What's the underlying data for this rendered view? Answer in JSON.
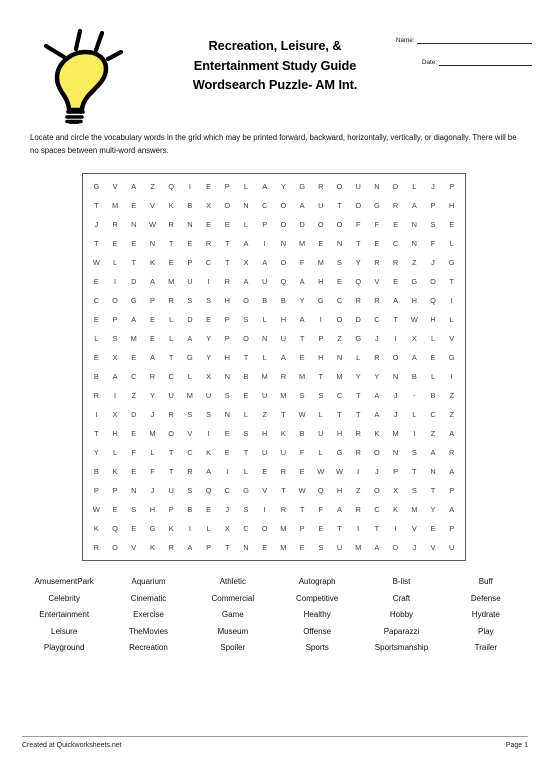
{
  "document": {
    "title_lines": [
      "Recreation, Leisure, &",
      "Entertainment Study Guide",
      "Wordsearch Puzzle- AM Int."
    ],
    "instructions": "Locate and circle the vocabulary words in the grid which may be printed forward, backward, horizontally, vertically, or diagonally. There will be no spaces between multi-word answers.",
    "icon": "lightbulb-icon",
    "icon_colors": {
      "bulb_fill": "#fbec5d",
      "outline": "#000000"
    }
  },
  "meta": {
    "name_label": "Name:",
    "date_label": "Date:"
  },
  "puzzle": {
    "rows": 20,
    "cols": 20,
    "grid": [
      [
        "G",
        "V",
        "A",
        "Z",
        "Q",
        "I",
        "E",
        "P",
        "L",
        "A",
        "Y",
        "G",
        "R",
        "O",
        "U",
        "N",
        "D",
        "L",
        "J",
        "P"
      ],
      [
        "T",
        "M",
        "E",
        "V",
        "K",
        "B",
        "X",
        "O",
        "N",
        "C",
        "O",
        "A",
        "U",
        "T",
        "O",
        "G",
        "R",
        "A",
        "P",
        "H"
      ],
      [
        "J",
        "R",
        "N",
        "W",
        "R",
        "N",
        "E",
        "E",
        "L",
        "P",
        "O",
        "D",
        "O",
        "O",
        "F",
        "F",
        "E",
        "N",
        "S",
        "E"
      ],
      [
        "T",
        "E",
        "E",
        "N",
        "T",
        "E",
        "R",
        "T",
        "A",
        "I",
        "N",
        "M",
        "E",
        "N",
        "T",
        "E",
        "C",
        "N",
        "F",
        "L"
      ],
      [
        "W",
        "L",
        "T",
        "K",
        "E",
        "P",
        "C",
        "T",
        "X",
        "A",
        "O",
        "F",
        "M",
        "S",
        "Y",
        "R",
        "R",
        "Z",
        "J",
        "G"
      ],
      [
        "E",
        "I",
        "D",
        "A",
        "M",
        "U",
        "I",
        "R",
        "A",
        "U",
        "Q",
        "A",
        "H",
        "E",
        "Q",
        "V",
        "E",
        "G",
        "O",
        "T"
      ],
      [
        "C",
        "O",
        "G",
        "P",
        "R",
        "S",
        "S",
        "H",
        "O",
        "B",
        "B",
        "Y",
        "G",
        "C",
        "R",
        "R",
        "A",
        "H",
        "Q",
        "I"
      ],
      [
        "E",
        "P",
        "A",
        "E",
        "L",
        "D",
        "E",
        "P",
        "S",
        "L",
        "H",
        "A",
        "I",
        "O",
        "D",
        "C",
        "T",
        "W",
        "H",
        "L"
      ],
      [
        "L",
        "S",
        "M",
        "E",
        "L",
        "A",
        "Y",
        "P",
        "O",
        "N",
        "U",
        "T",
        "P",
        "Z",
        "G",
        "J",
        "I",
        "X",
        "L",
        "V"
      ],
      [
        "E",
        "X",
        "E",
        "A",
        "T",
        "G",
        "Y",
        "H",
        "T",
        "L",
        "A",
        "E",
        "H",
        "N",
        "L",
        "R",
        "O",
        "A",
        "E",
        "G"
      ],
      [
        "B",
        "A",
        "C",
        "R",
        "C",
        "L",
        "X",
        "N",
        "B",
        "M",
        "R",
        "M",
        "T",
        "M",
        "Y",
        "Y",
        "N",
        "B",
        "L",
        "I"
      ],
      [
        "R",
        "I",
        "Z",
        "Y",
        "U",
        "M",
        "U",
        "S",
        "E",
        "U",
        "M",
        "S",
        "S",
        "C",
        "T",
        "A",
        "J",
        "-",
        "B",
        "Z"
      ],
      [
        "I",
        "X",
        "D",
        "J",
        "R",
        "S",
        "S",
        "N",
        "L",
        "Z",
        "T",
        "W",
        "L",
        "T",
        "T",
        "A",
        "J",
        "L",
        "C",
        "Z"
      ],
      [
        "T",
        "H",
        "E",
        "M",
        "O",
        "V",
        "I",
        "E",
        "S",
        "H",
        "K",
        "B",
        "U",
        "H",
        "R",
        "K",
        "M",
        "I",
        "Z",
        "A"
      ],
      [
        "Y",
        "L",
        "F",
        "L",
        "T",
        "C",
        "K",
        "E",
        "T",
        "U",
        "U",
        "F",
        "L",
        "G",
        "R",
        "O",
        "N",
        "S",
        "A",
        "R"
      ],
      [
        "B",
        "K",
        "E",
        "F",
        "T",
        "R",
        "A",
        "I",
        "L",
        "E",
        "R",
        "E",
        "W",
        "W",
        "I",
        "J",
        "P",
        "T",
        "N",
        "A"
      ],
      [
        "P",
        "P",
        "N",
        "J",
        "U",
        "S",
        "Q",
        "C",
        "G",
        "V",
        "T",
        "W",
        "Q",
        "H",
        "Z",
        "O",
        "X",
        "S",
        "T",
        "P"
      ],
      [
        "W",
        "E",
        "S",
        "H",
        "P",
        "B",
        "E",
        "J",
        "S",
        "I",
        "R",
        "T",
        "F",
        "A",
        "R",
        "C",
        "K",
        "M",
        "Y",
        "A"
      ],
      [
        "K",
        "Q",
        "E",
        "G",
        "K",
        "I",
        "L",
        "X",
        "C",
        "O",
        "M",
        "P",
        "E",
        "T",
        "I",
        "T",
        "I",
        "V",
        "E",
        "P"
      ],
      [
        "R",
        "O",
        "V",
        "K",
        "R",
        "A",
        "P",
        "T",
        "N",
        "E",
        "M",
        "E",
        "S",
        "U",
        "M",
        "A",
        "D",
        "J",
        "V",
        "U"
      ]
    ]
  },
  "wordlist": {
    "columns": 6,
    "rows": [
      [
        "AmusementPark",
        "Aquarium",
        "Athletic",
        "Autograph",
        "B-list",
        "Buff"
      ],
      [
        "Celebrity",
        "Cinematic",
        "Commercial",
        "Competitive",
        "Craft",
        "Defense"
      ],
      [
        "Entertainment",
        "Exercise",
        "Game",
        "Healthy",
        "Hobby",
        "Hydrate"
      ],
      [
        "Leisure",
        "TheMovies",
        "Museum",
        "Offense",
        "Paparazzi",
        "Play"
      ],
      [
        "Playground",
        "Recreation",
        "Spoiler",
        "Sports",
        "Sportsmanship",
        "Trailer"
      ]
    ]
  },
  "footer": {
    "credit": "Created at Quickworksheets.net",
    "page": "Page 1"
  }
}
